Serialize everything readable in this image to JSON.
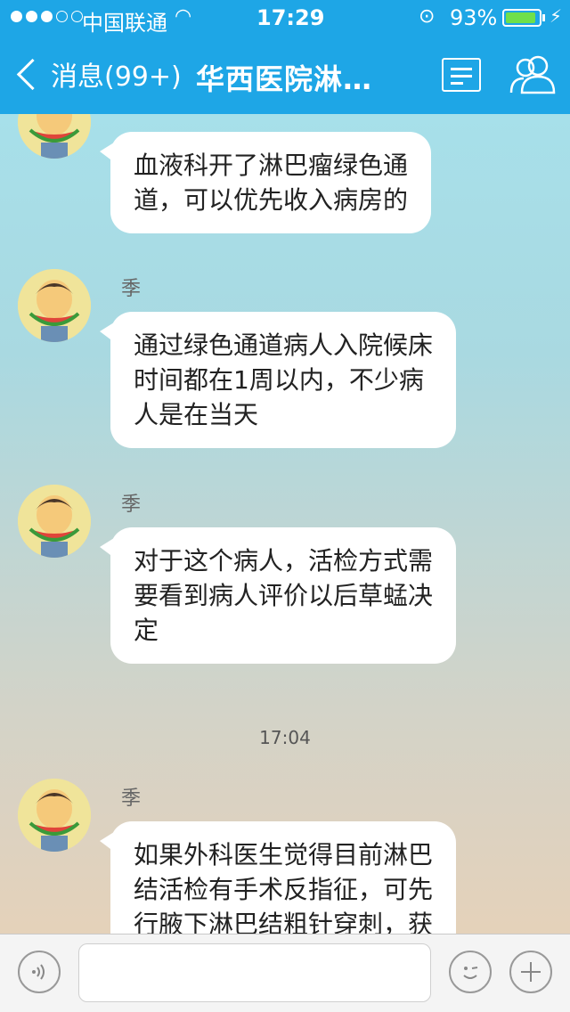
{
  "status_bar": {
    "carrier": "中国联通",
    "time": "17:29",
    "battery_percent": "93%",
    "battery_level": 0.93,
    "signal_bars": 3
  },
  "nav": {
    "back_label": "消息(99+)",
    "title": "华西医院淋…",
    "icons": {
      "menu": "list-icon",
      "members": "people-icon"
    }
  },
  "messages": [
    {
      "text_lines": [
        "血液科开了淋巴瘤绿色通",
        "道，可以优先收入病房的"
      ]
    },
    {
      "sender": "季",
      "text_lines": [
        "通过绿色通道病人入院候床",
        "时间都在1周以内，不少病",
        "人是在当天"
      ]
    },
    {
      "sender": "季",
      "text_lines": [
        "对于这个病人，活检方式需",
        "要看到病人评价以后草蜢决",
        "定"
      ]
    },
    {
      "timestamp": "17:04"
    },
    {
      "sender": "季",
      "text_lines": [
        "如果外科医生觉得目前淋巴",
        "结活检有手术反指征，可先",
        "行腋下淋巴结粗针穿刺，获"
      ]
    }
  ],
  "input_bar": {
    "value": "",
    "icons": {
      "voice": "voice-icon",
      "emoji": "emoji-icon",
      "more": "plus-icon"
    }
  },
  "colors": {
    "header": "#1ea6e6",
    "bubble": "#ffffff",
    "battery": "#6fe04a"
  }
}
